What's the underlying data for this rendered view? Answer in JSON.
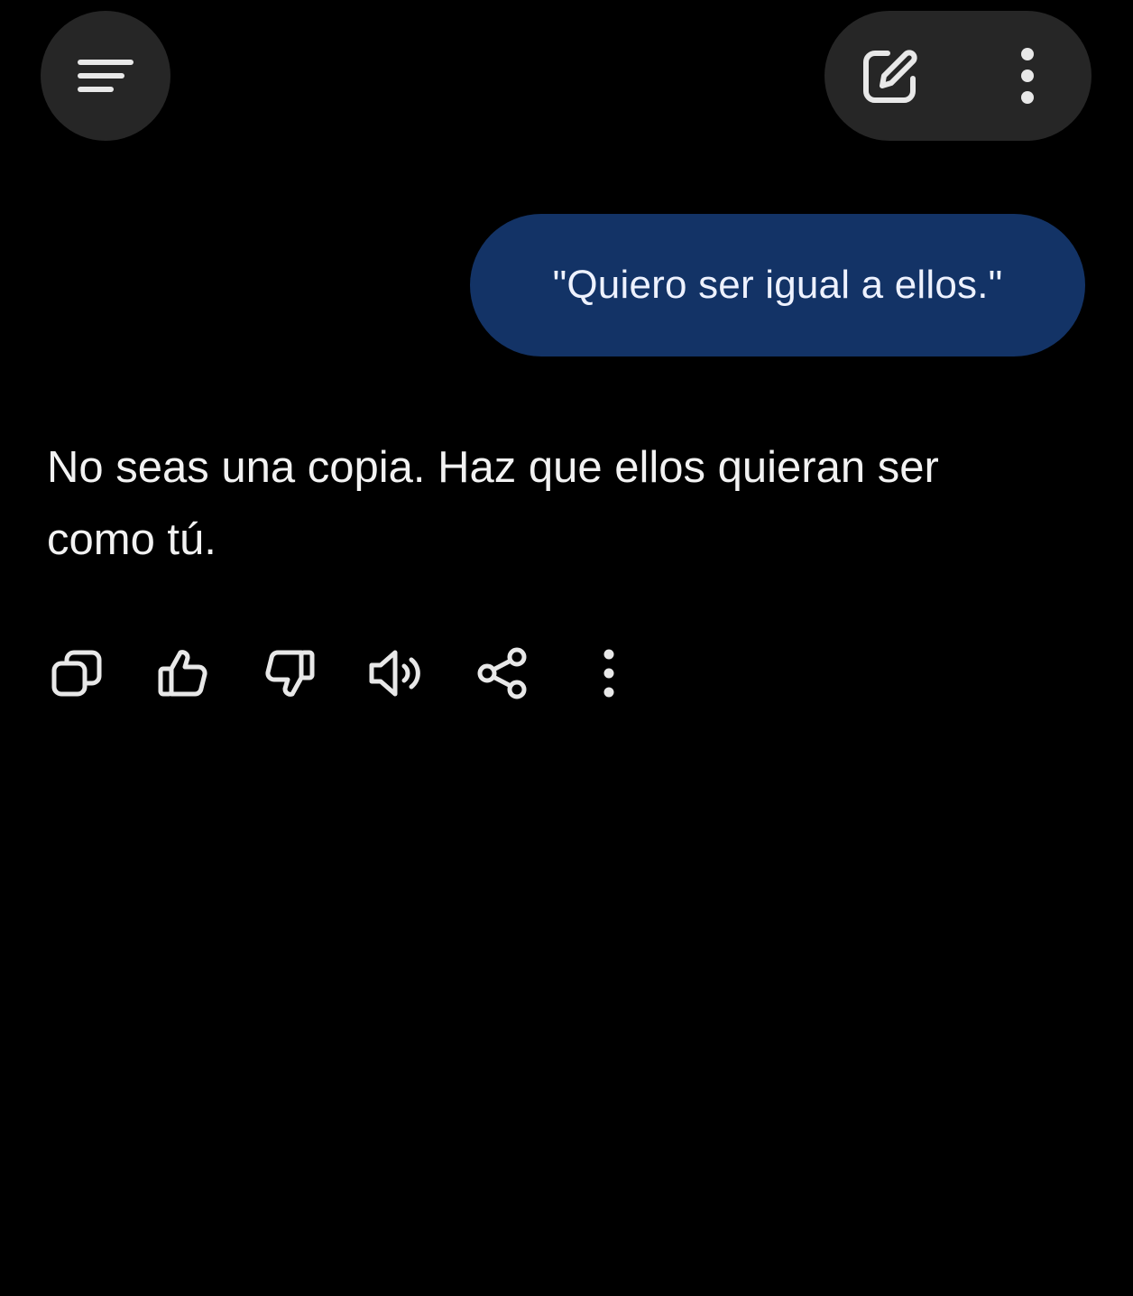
{
  "colors": {
    "background": "#000000",
    "toolbar_surface": "#262626",
    "user_bubble": "#133366",
    "text": "#f2f2f2",
    "icon": "#e8e8e8"
  },
  "header": {
    "menu_icon": "menu-icon",
    "actions": [
      {
        "name": "new-chat-button",
        "icon": "edit-icon"
      },
      {
        "name": "more-options-button",
        "icon": "more-vertical-icon"
      }
    ]
  },
  "conversation": {
    "user_message": "\"Quiero ser igual a ellos.\"",
    "assistant_response": "No seas una copia. Haz que ellos quieran ser como tú.",
    "response_actions": [
      {
        "name": "copy-button",
        "icon": "copy-icon"
      },
      {
        "name": "thumbs-up-button",
        "icon": "thumbs-up-icon"
      },
      {
        "name": "thumbs-down-button",
        "icon": "thumbs-down-icon"
      },
      {
        "name": "read-aloud-button",
        "icon": "speaker-icon"
      },
      {
        "name": "share-button",
        "icon": "share-icon"
      },
      {
        "name": "response-more-button",
        "icon": "more-vertical-icon"
      }
    ]
  }
}
